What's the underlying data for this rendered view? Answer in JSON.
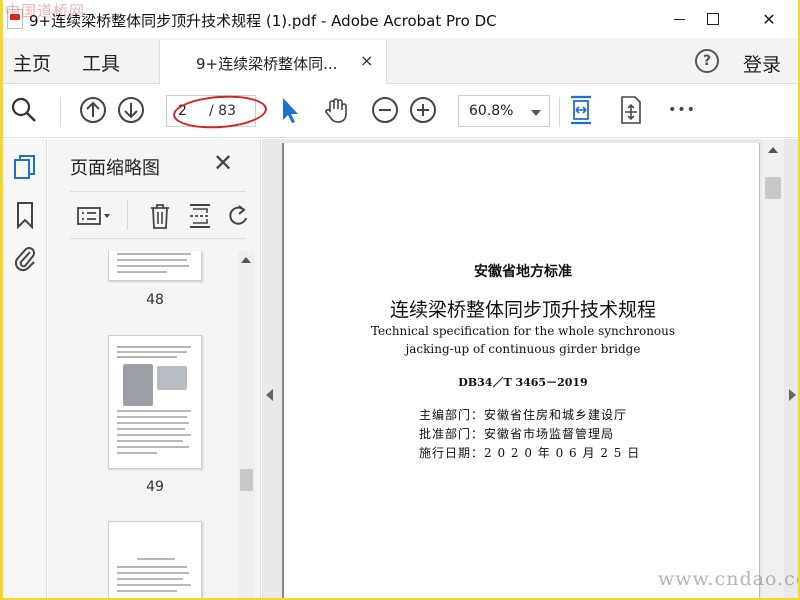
{
  "window": {
    "title": "9+连续梁桥整体同步顶升技术规程 (1).pdf - Adobe Acrobat Pro DC",
    "watermark_top": "中国道桥网",
    "close_glyph": "✕"
  },
  "tabs": {
    "home": "主页",
    "tools": "工具",
    "document": "9+连续梁桥整体同...",
    "document_close": "×",
    "help": "?",
    "login": "登录"
  },
  "toolbar": {
    "current_page": "2",
    "total_pages": "/ 83",
    "zoom": "60.8%",
    "more": "•••"
  },
  "thumbnail_panel": {
    "title": "页面缩略图",
    "close": "✕",
    "pages": [
      {
        "number": "48"
      },
      {
        "number": "49"
      },
      {
        "number": ""
      }
    ]
  },
  "document": {
    "standard_type": "安徽省地方标准",
    "title_cn": "连续梁桥整体同步顶升技术规程",
    "title_en_line1": "Technical specification for the whole synchronous",
    "title_en_line2": "jacking-up of continuous girder bridge",
    "code": "DB34／T 3465－2019",
    "editor": "主编部门：安徽省住房和城乡建设厅",
    "approver": "批准部门：安徽省市场监督管理局",
    "effective": "施行日期：2 0 2 0 年 0 6 月 2 5 日"
  },
  "watermark_bottom": "www.cndao.com",
  "colors": {
    "accent_blue": "#1f6fd1",
    "annotation_red": "#d8201c",
    "frame_yellow": "#f4d830"
  }
}
